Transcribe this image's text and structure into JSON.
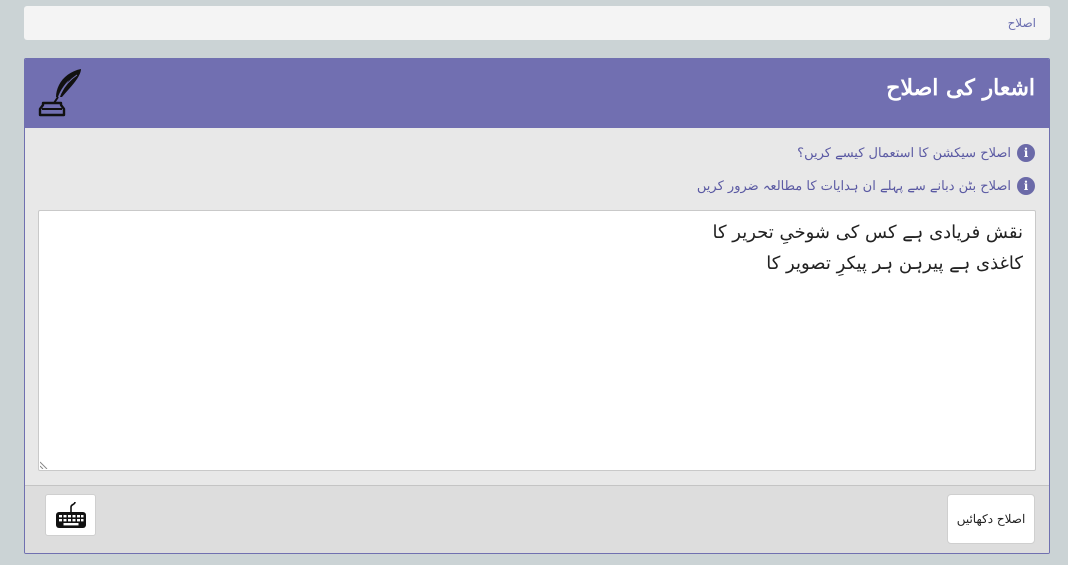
{
  "breadcrumb": {
    "items": [
      "اصلاح"
    ]
  },
  "panel": {
    "title": "اشعار کی اصلاح",
    "icon": "quill-inkwell-icon",
    "header_color": "#716fb1"
  },
  "info_links": [
    {
      "text": "اصلاح سیکشن کا استعمال کیسے کریں؟",
      "icon": "info-icon"
    },
    {
      "text": "اصلاح بٹن دبانے سے پہلے ان ہدایات کا مطالعہ ضرور کریں",
      "icon": "info-icon"
    }
  ],
  "editor": {
    "lines": [
      "نقش فریادی ہے کس کی شوخیِ تحریر کا",
      "کاغذی ہے پیرہن ہر پیکرِ تصویر کا"
    ]
  },
  "footer": {
    "submit_label": "اصلاح دکھائیں",
    "keyboard_icon": "keyboard-icon"
  }
}
